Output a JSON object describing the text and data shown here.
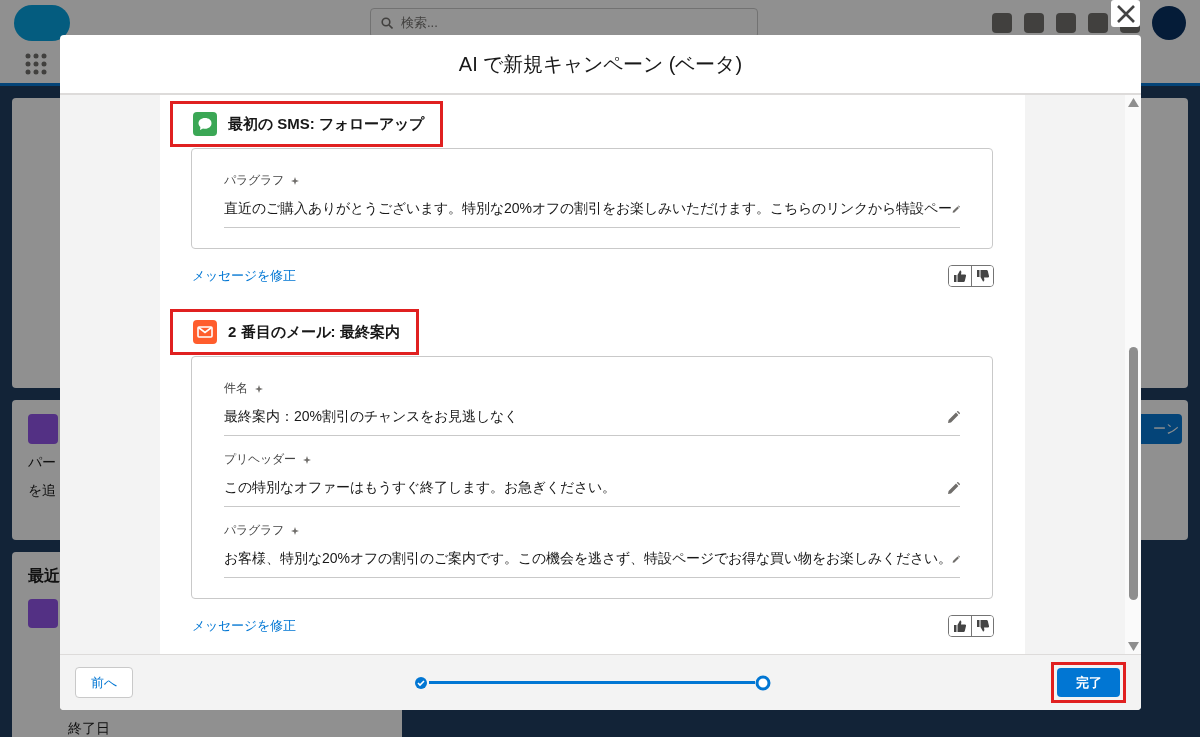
{
  "background_page": {
    "search": {
      "placeholder": "検索..."
    },
    "left_texts": [
      "パー",
      "を追"
    ],
    "recent_heading": "最近",
    "end_date_label": "終了日",
    "right_button": "ーン"
  },
  "modal": {
    "title": "AI で新規キャンペーン (ベータ)",
    "sections": [
      {
        "kind": "sms",
        "title": "最初の SMS: フォローアップ",
        "highlighted": true,
        "fields": [
          {
            "label": "パラグラフ",
            "value": "直近のご購入ありがとうございます。特別な20%オフの割引をお楽しみいただけます。こちらのリンクから特設ペー"
          }
        ],
        "revise_link": "メッセージを修正"
      },
      {
        "kind": "email",
        "title": "2 番目のメール: 最終案内",
        "highlighted": true,
        "fields": [
          {
            "label": "件名",
            "value": "最終案内：20%割引のチャンスをお見逃しなく"
          },
          {
            "label": "プリヘッダー",
            "value": "この特別なオファーはもうすぐ終了します。お急ぎください。"
          },
          {
            "label": "パラグラフ",
            "value": "お客様、特別な20%オフの割引のご案内です。この機会を逃さず、特設ページでお得な買い物をお楽しみください。"
          }
        ],
        "revise_link": "メッセージを修正"
      }
    ],
    "footer": {
      "back_button": "前へ",
      "steps": [
        {
          "complete": true
        },
        {
          "complete": false
        }
      ],
      "finish_button": {
        "label": "完了",
        "highlighted": true
      }
    }
  }
}
